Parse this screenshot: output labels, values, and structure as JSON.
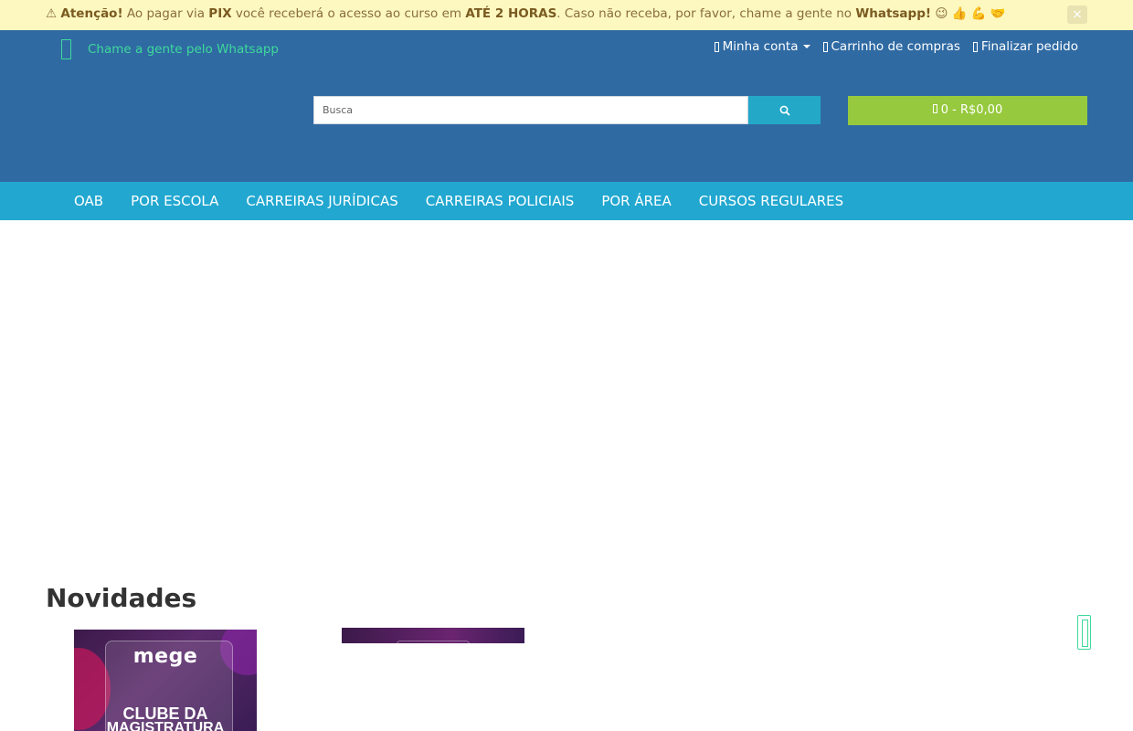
{
  "alert": {
    "icon": "⚠",
    "attention": "Atenção!",
    "text1": " Ao pagar via ",
    "pix": "PIX",
    "text2": " você receberá o acesso ao curso em ",
    "hours": "ATÉ 2 HORAS",
    "text3": ". Caso não receba, por favor, chame a gente no ",
    "whatsapp": "Whatsapp!",
    "emojis": " 😉 👍 💪 🤝",
    "close": "×"
  },
  "header": {
    "whatsapp_link": "Chame a gente pelo Whatsapp",
    "top_nav": {
      "account": "Minha conta",
      "cart": "Carrinho de compras",
      "checkout": "Finalizar pedido"
    },
    "search": {
      "placeholder": "Busca"
    },
    "cart_summary": "0 - R$0,00"
  },
  "main_nav": {
    "items": [
      "OAB",
      "POR ESCOLA",
      "CARREIRAS JURÍDICAS",
      "CARREIRAS POLICIAIS",
      "POR ÁREA",
      "CURSOS REGULARES"
    ]
  },
  "news": {
    "title": "Novidades",
    "products": [
      {
        "logo": "mege",
        "line1": "CLUBE DA",
        "line2": "MAGISTRATURA"
      }
    ]
  },
  "colors": {
    "header_bg": "#2f6aa3",
    "nav_bg": "#21a7d0",
    "cart_bg": "#96c93d",
    "search_btn_bg": "#23a8c8",
    "alert_bg": "#fcf8c0",
    "whatsapp_green": "#3ed99a"
  }
}
